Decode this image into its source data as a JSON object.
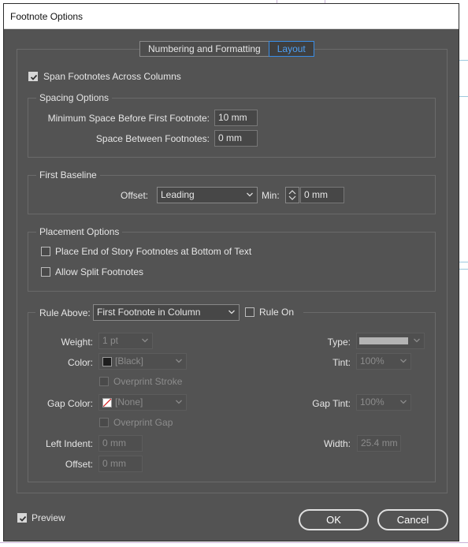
{
  "window": {
    "title": "Footnote Options"
  },
  "tabs": [
    {
      "label": "Numbering and Formatting",
      "active": false
    },
    {
      "label": "Layout",
      "active": true
    }
  ],
  "span_footnotes": {
    "label": "Span Footnotes Across Columns",
    "checked": true
  },
  "spacing": {
    "legend": "Spacing Options",
    "min_space_label": "Minimum Space Before First Footnote:",
    "min_space_value": "10 mm",
    "between_label": "Space Between Footnotes:",
    "between_value": "0 mm"
  },
  "first_baseline": {
    "legend": "First Baseline",
    "offset_label": "Offset:",
    "offset_value": "Leading",
    "min_label": "Min:",
    "min_value": "0 mm"
  },
  "placement": {
    "legend": "Placement Options",
    "end_of_story_label": "Place End of Story Footnotes at Bottom of Text",
    "end_of_story_checked": false,
    "allow_split_label": "Allow Split Footnotes",
    "allow_split_checked": false
  },
  "rule": {
    "rule_above_label": "Rule Above:",
    "rule_above_value": "First Footnote in Column",
    "rule_on_label": "Rule On",
    "rule_on_checked": false,
    "weight_label": "Weight:",
    "weight_value": "1 pt",
    "type_label": "Type:",
    "color_label": "Color:",
    "color_value": "[Black]",
    "tint_label": "Tint:",
    "tint_value": "100%",
    "overprint_stroke_label": "Overprint Stroke",
    "gap_color_label": "Gap Color:",
    "gap_color_value": "[None]",
    "gap_tint_label": "Gap Tint:",
    "gap_tint_value": "100%",
    "overprint_gap_label": "Overprint Gap",
    "left_indent_label": "Left Indent:",
    "left_indent_value": "0 mm",
    "width_label": "Width:",
    "width_value": "25.4 mm",
    "offset_label": "Offset:",
    "offset_value": "0 mm"
  },
  "footer": {
    "preview_label": "Preview",
    "preview_checked": true,
    "ok_label": "OK",
    "cancel_label": "Cancel"
  },
  "icons": {
    "chevron": "chevron-down-icon",
    "check": "checkmark-icon",
    "spinner": "stepper-arrows-icon"
  },
  "colors": {
    "dialog_bg": "#535353",
    "accent": "#3a8ee6",
    "swatch_black": "#1e1e1e",
    "none_slash": "#d42020"
  }
}
